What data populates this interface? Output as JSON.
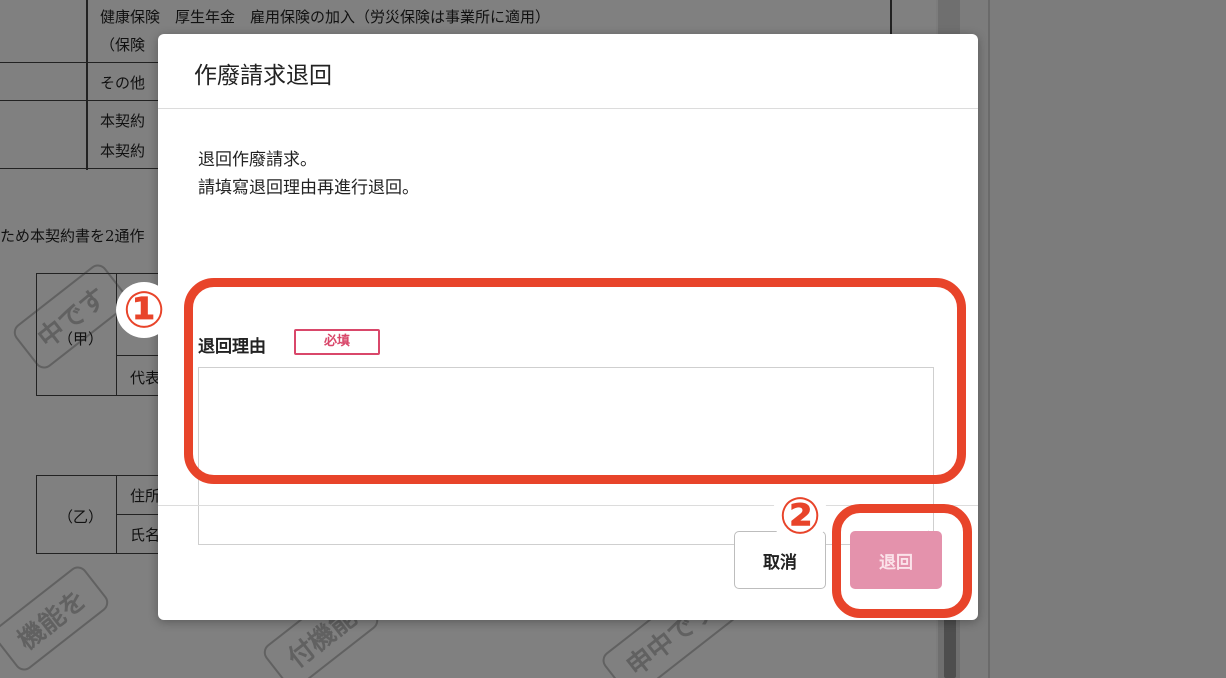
{
  "background_document": {
    "rows": [
      "健康保険　厚生年金　雇用保険の加入（労災保険は事業所に適用）",
      "（保険",
      "その他",
      "本契約",
      "本契約"
    ],
    "closing_text": "ため本契約書を2通作",
    "party_a_label": "（甲）",
    "party_a_rep": "代表",
    "party_b_label": "（乙）",
    "party_b_address": "住所",
    "party_b_name": "氏名",
    "watermark_1": "機能を",
    "watermark_2": "中です",
    "watermark_3": "付機能",
    "watermark_4": "申中です"
  },
  "modal": {
    "title": "作廢請求退回",
    "description_line1": "退回作廢請求。",
    "description_line2": "請填寫退回理由再進行退回。",
    "field_label": "退回理由",
    "required_badge": "必填",
    "textarea_value": "",
    "cancel_label": "取消",
    "submit_label": "退回"
  },
  "annotations": {
    "marker_1": "①",
    "marker_2": "②",
    "highlight_color": "#e8442a"
  },
  "colors": {
    "accent_pink": "#d9476a",
    "submit_disabled": "#e492ac"
  }
}
